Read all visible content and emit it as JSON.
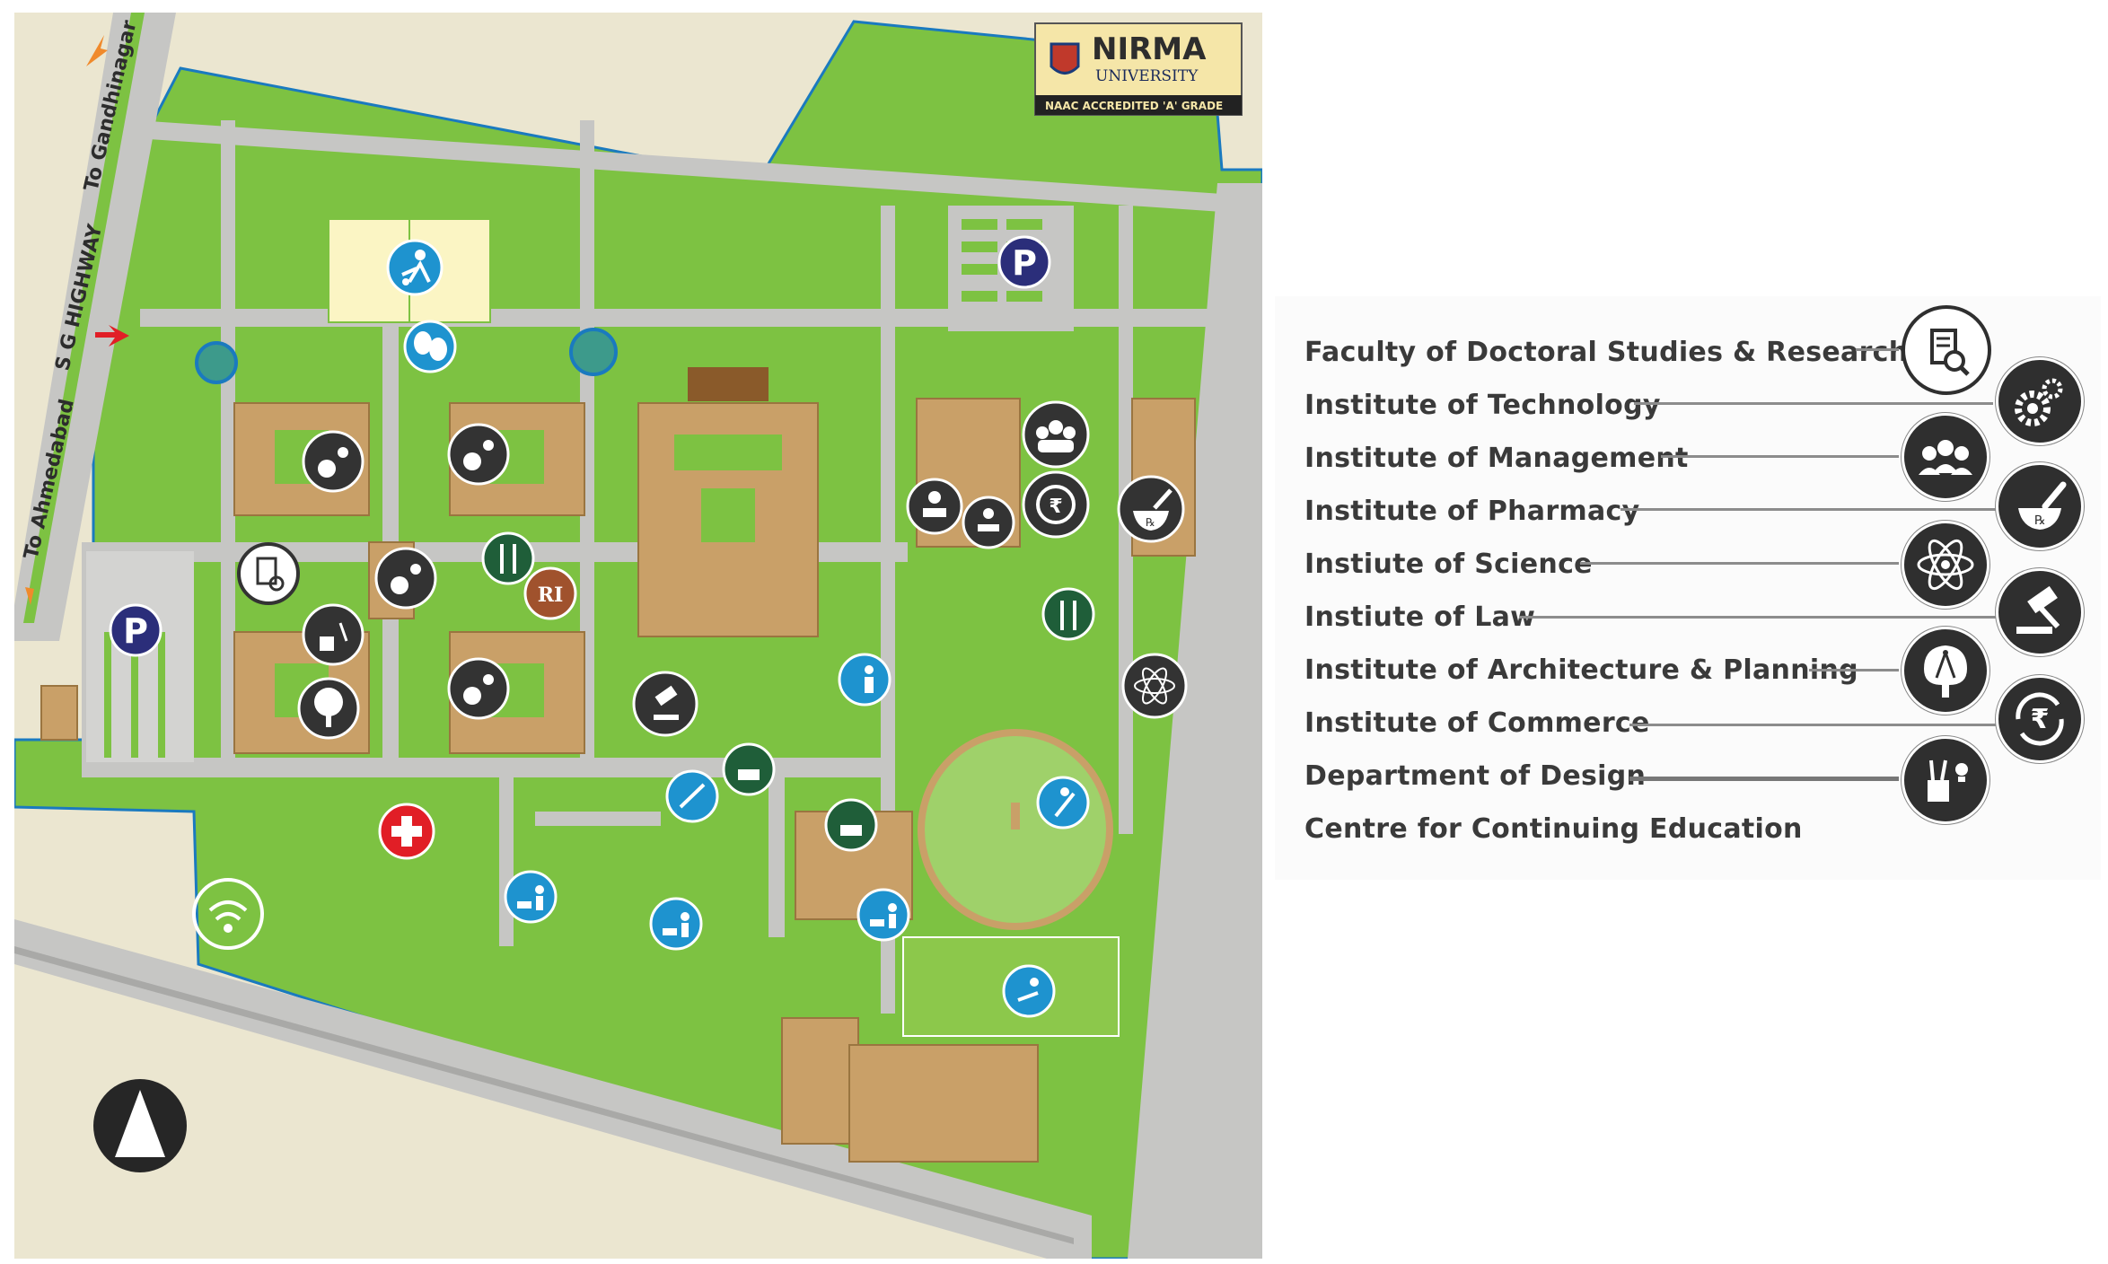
{
  "logo": {
    "name": "NIRMA",
    "subtitle": "UNIVERSITY",
    "accreditation": "NAAC ACCREDITED 'A' GRADE"
  },
  "map_labels": {
    "highway": "S G HIGHWAY",
    "to_gandhinagar": "To Gandhinagar",
    "to_ahmedabad": "To Ahmedabad",
    "parking": "P",
    "pharmacy_symbol": "℞",
    "library_symbol": "RI"
  },
  "colors": {
    "campus_green": "#7dc242",
    "road_grey": "#c6c6c4",
    "outside_beige": "#ebe6d0",
    "building_tan": "#c9a068",
    "water_teal": "#3d9a8b",
    "icon_dark": "#333333",
    "icon_blue": "#1e93cf",
    "icon_food_green": "#1f5e39",
    "parking_navy": "#2b2e7a",
    "medical_red": "#e11e26",
    "boundary_blue": "#1a7abf"
  },
  "legend": [
    {
      "label": "Faculty of Doctoral Studies & Research",
      "icon": "document-magnifier-icon"
    },
    {
      "label": "Institute of Technology",
      "icon": "gears-icon"
    },
    {
      "label": "Institute of Management",
      "icon": "people-group-icon"
    },
    {
      "label": "Institute of Pharmacy",
      "icon": "mortar-pestle-icon"
    },
    {
      "label": "Instiute of Science",
      "icon": "atom-icon"
    },
    {
      "label": "Instiute of Law",
      "icon": "gavel-icon"
    },
    {
      "label": "Institute of Architecture & Planning",
      "icon": "compass-tree-icon"
    },
    {
      "label": "Institute of Commerce",
      "icon": "rupee-cycle-icon"
    },
    {
      "label": "Department of Design",
      "icon": "design-tools-icon"
    },
    {
      "label": "Centre for Continuing Education",
      "icon": ""
    }
  ]
}
